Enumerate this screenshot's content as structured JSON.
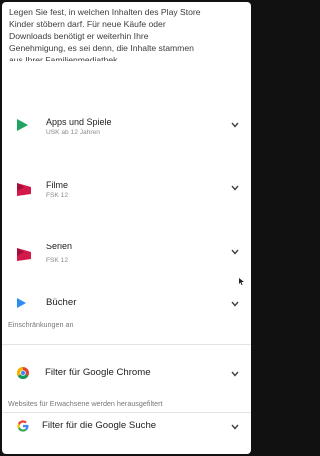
{
  "intro_lines": [
    "Legen Sie fest, in welchen Inhalten des Play Store",
    "Kinder stöbern darf. Für neue Käufe oder",
    "Downloads benötigt er weiterhin Ihre",
    "Genehmigung, es sei denn, die Inhalte stammen",
    "aus Ihrer Familienmediathek"
  ],
  "apps": {
    "title": "Apps und Spiele",
    "rating": "USK ab 12 Jahren",
    "icon": "play-triangle-icon",
    "color": "#1fa463"
  },
  "movies": {
    "title": "Filme",
    "rating": "FSK 12",
    "icon": "movies-flag-icon",
    "color": "#d3184a"
  },
  "series": {
    "title": "Serien",
    "rating": "FSK 12",
    "icon": "tv-flag-icon",
    "color": "#d3184a"
  },
  "books": {
    "title": "Bücher",
    "note": "Einschränkungen an",
    "icon": "books-triangle-icon",
    "color": "#2a8ff0"
  },
  "chrome": {
    "title": "Filter für Google Chrome",
    "note": "Websites für Erwachsene werden herausgefiltert",
    "icon": "chrome-icon"
  },
  "search": {
    "title": "Filter für die Google Suche",
    "icon": "google-g-icon"
  }
}
